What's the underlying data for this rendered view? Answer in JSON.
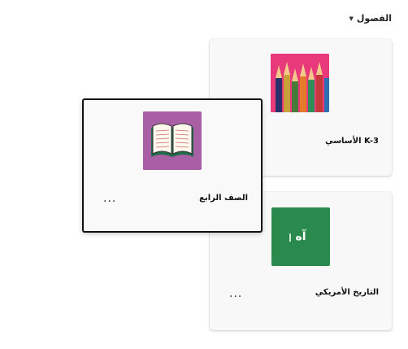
{
  "header": {
    "title": "الفصول"
  },
  "cards": [
    {
      "title": "K-3 الأساسي",
      "thumbnail": "pencils-image"
    },
    {
      "title": "الصف الرابع",
      "thumbnail": "book-image",
      "more": "..."
    },
    {
      "title": "التاريخ الأمريكي",
      "thumbnail_text": "آه",
      "more": "..."
    }
  ],
  "colors": {
    "pink": "#e8397a",
    "purple": "#a95fa4",
    "green": "#2a8a4e"
  }
}
